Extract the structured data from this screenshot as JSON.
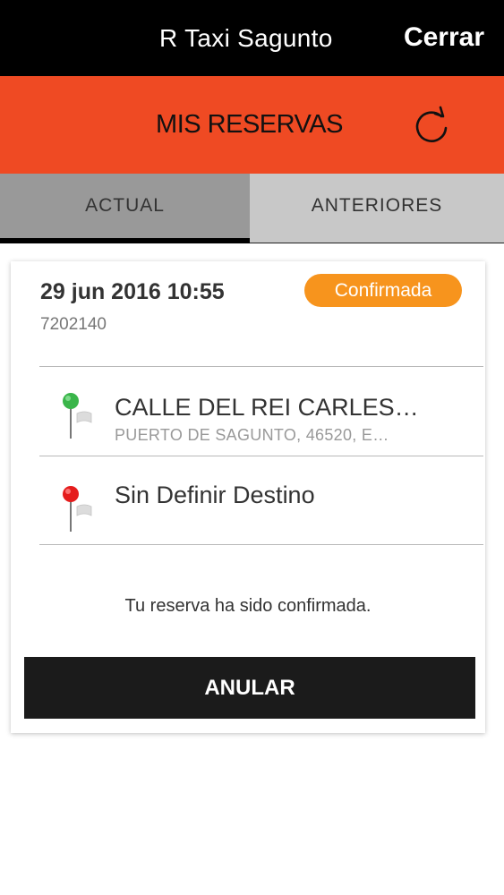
{
  "topbar": {
    "app_title": "R Taxi Sagunto",
    "close_label": "Cerrar"
  },
  "header": {
    "title": "MIS RESERVAS",
    "refresh_icon": "refresh-icon",
    "accent_color": "#ef4a23"
  },
  "tabs": [
    {
      "label": "ACTUAL",
      "selected": true
    },
    {
      "label": "ANTERIORES",
      "selected": false
    }
  ],
  "booking": {
    "datetime": "29 jun 2016 10:55",
    "id": "7202140",
    "status": "Confirmada",
    "status_color": "#f7941d",
    "origin": {
      "title": "CALLE DEL REI CARLES…",
      "subtitle": "PUERTO DE SAGUNTO,  46520,  E…",
      "icon": "green-pin-icon"
    },
    "destination": {
      "title": "Sin Definir Destino",
      "icon": "red-pin-icon"
    },
    "message": "Tu reserva ha sido confirmada.",
    "cancel_label": "ANULAR"
  }
}
